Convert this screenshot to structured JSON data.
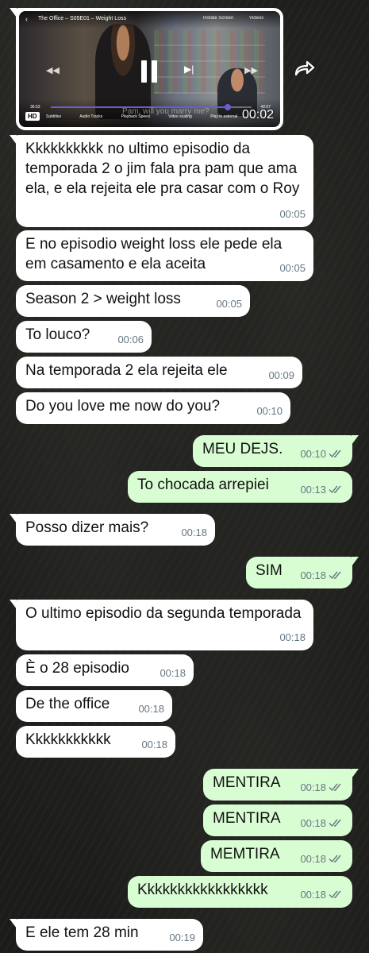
{
  "video": {
    "title": "The Office – S05E01 – Weight Loss",
    "rotate_label": "Rotate Screen",
    "videos_label": "Videos",
    "quality": "HD",
    "elapsed": "36:53",
    "total": "42:07",
    "progress_fraction": 0.88,
    "subtitle": "Pam, will you marry me?",
    "options": [
      "Subtitles",
      "Audio Tracks",
      "Playback Speed",
      "Video scaling",
      "Play in external"
    ],
    "duration": "00:02"
  },
  "messages": [
    {
      "dir": "in",
      "text": "Kkkkkkkkkk no ultimo episodio da temporada 2 o jim fala pra pam que ama ela, e ela rejeita ele pra casar com o Roy",
      "time": "00:05"
    },
    {
      "dir": "in",
      "text": "E no episodio weight loss ele pede ela em casamento e ela aceita",
      "time": "00:05"
    },
    {
      "dir": "in",
      "text": "Season 2 > weight loss",
      "time": "00:05"
    },
    {
      "dir": "in",
      "text": "To louco?",
      "time": "00:06"
    },
    {
      "dir": "in",
      "text": "Na temporada 2 ela rejeita ele",
      "time": "00:09"
    },
    {
      "dir": "in",
      "text": "Do you love me now do you?",
      "time": "00:10"
    },
    {
      "dir": "out",
      "text": "MEU DEJS.",
      "time": "00:10"
    },
    {
      "dir": "out",
      "text": "To chocada arrepiei",
      "time": "00:13"
    },
    {
      "dir": "in",
      "text": "Posso dizer mais?",
      "time": "00:18"
    },
    {
      "dir": "out",
      "text": "SIM",
      "time": "00:18"
    },
    {
      "dir": "in",
      "text": "O ultimo episodio da segunda temporada",
      "time": "00:18"
    },
    {
      "dir": "in",
      "text": "È o 28 episodio",
      "time": "00:18"
    },
    {
      "dir": "in",
      "text": "De the office",
      "time": "00:18"
    },
    {
      "dir": "in",
      "text": "Kkkkkkkkkkk",
      "time": "00:18"
    },
    {
      "dir": "out",
      "text": "MENTIRA",
      "time": "00:18"
    },
    {
      "dir": "out",
      "text": "MENTIRA",
      "time": "00:18"
    },
    {
      "dir": "out",
      "text": "MEMTIRA",
      "time": "00:18"
    },
    {
      "dir": "out",
      "text": "Kkkkkkkkkkkkkkkkk",
      "time": "00:18"
    },
    {
      "dir": "in",
      "text": "E ele tem 28 min",
      "time": "00:19"
    }
  ],
  "colors": {
    "incoming": "#ffffff",
    "outgoing": "#d9fdd3",
    "read_ticks": "#667781"
  }
}
